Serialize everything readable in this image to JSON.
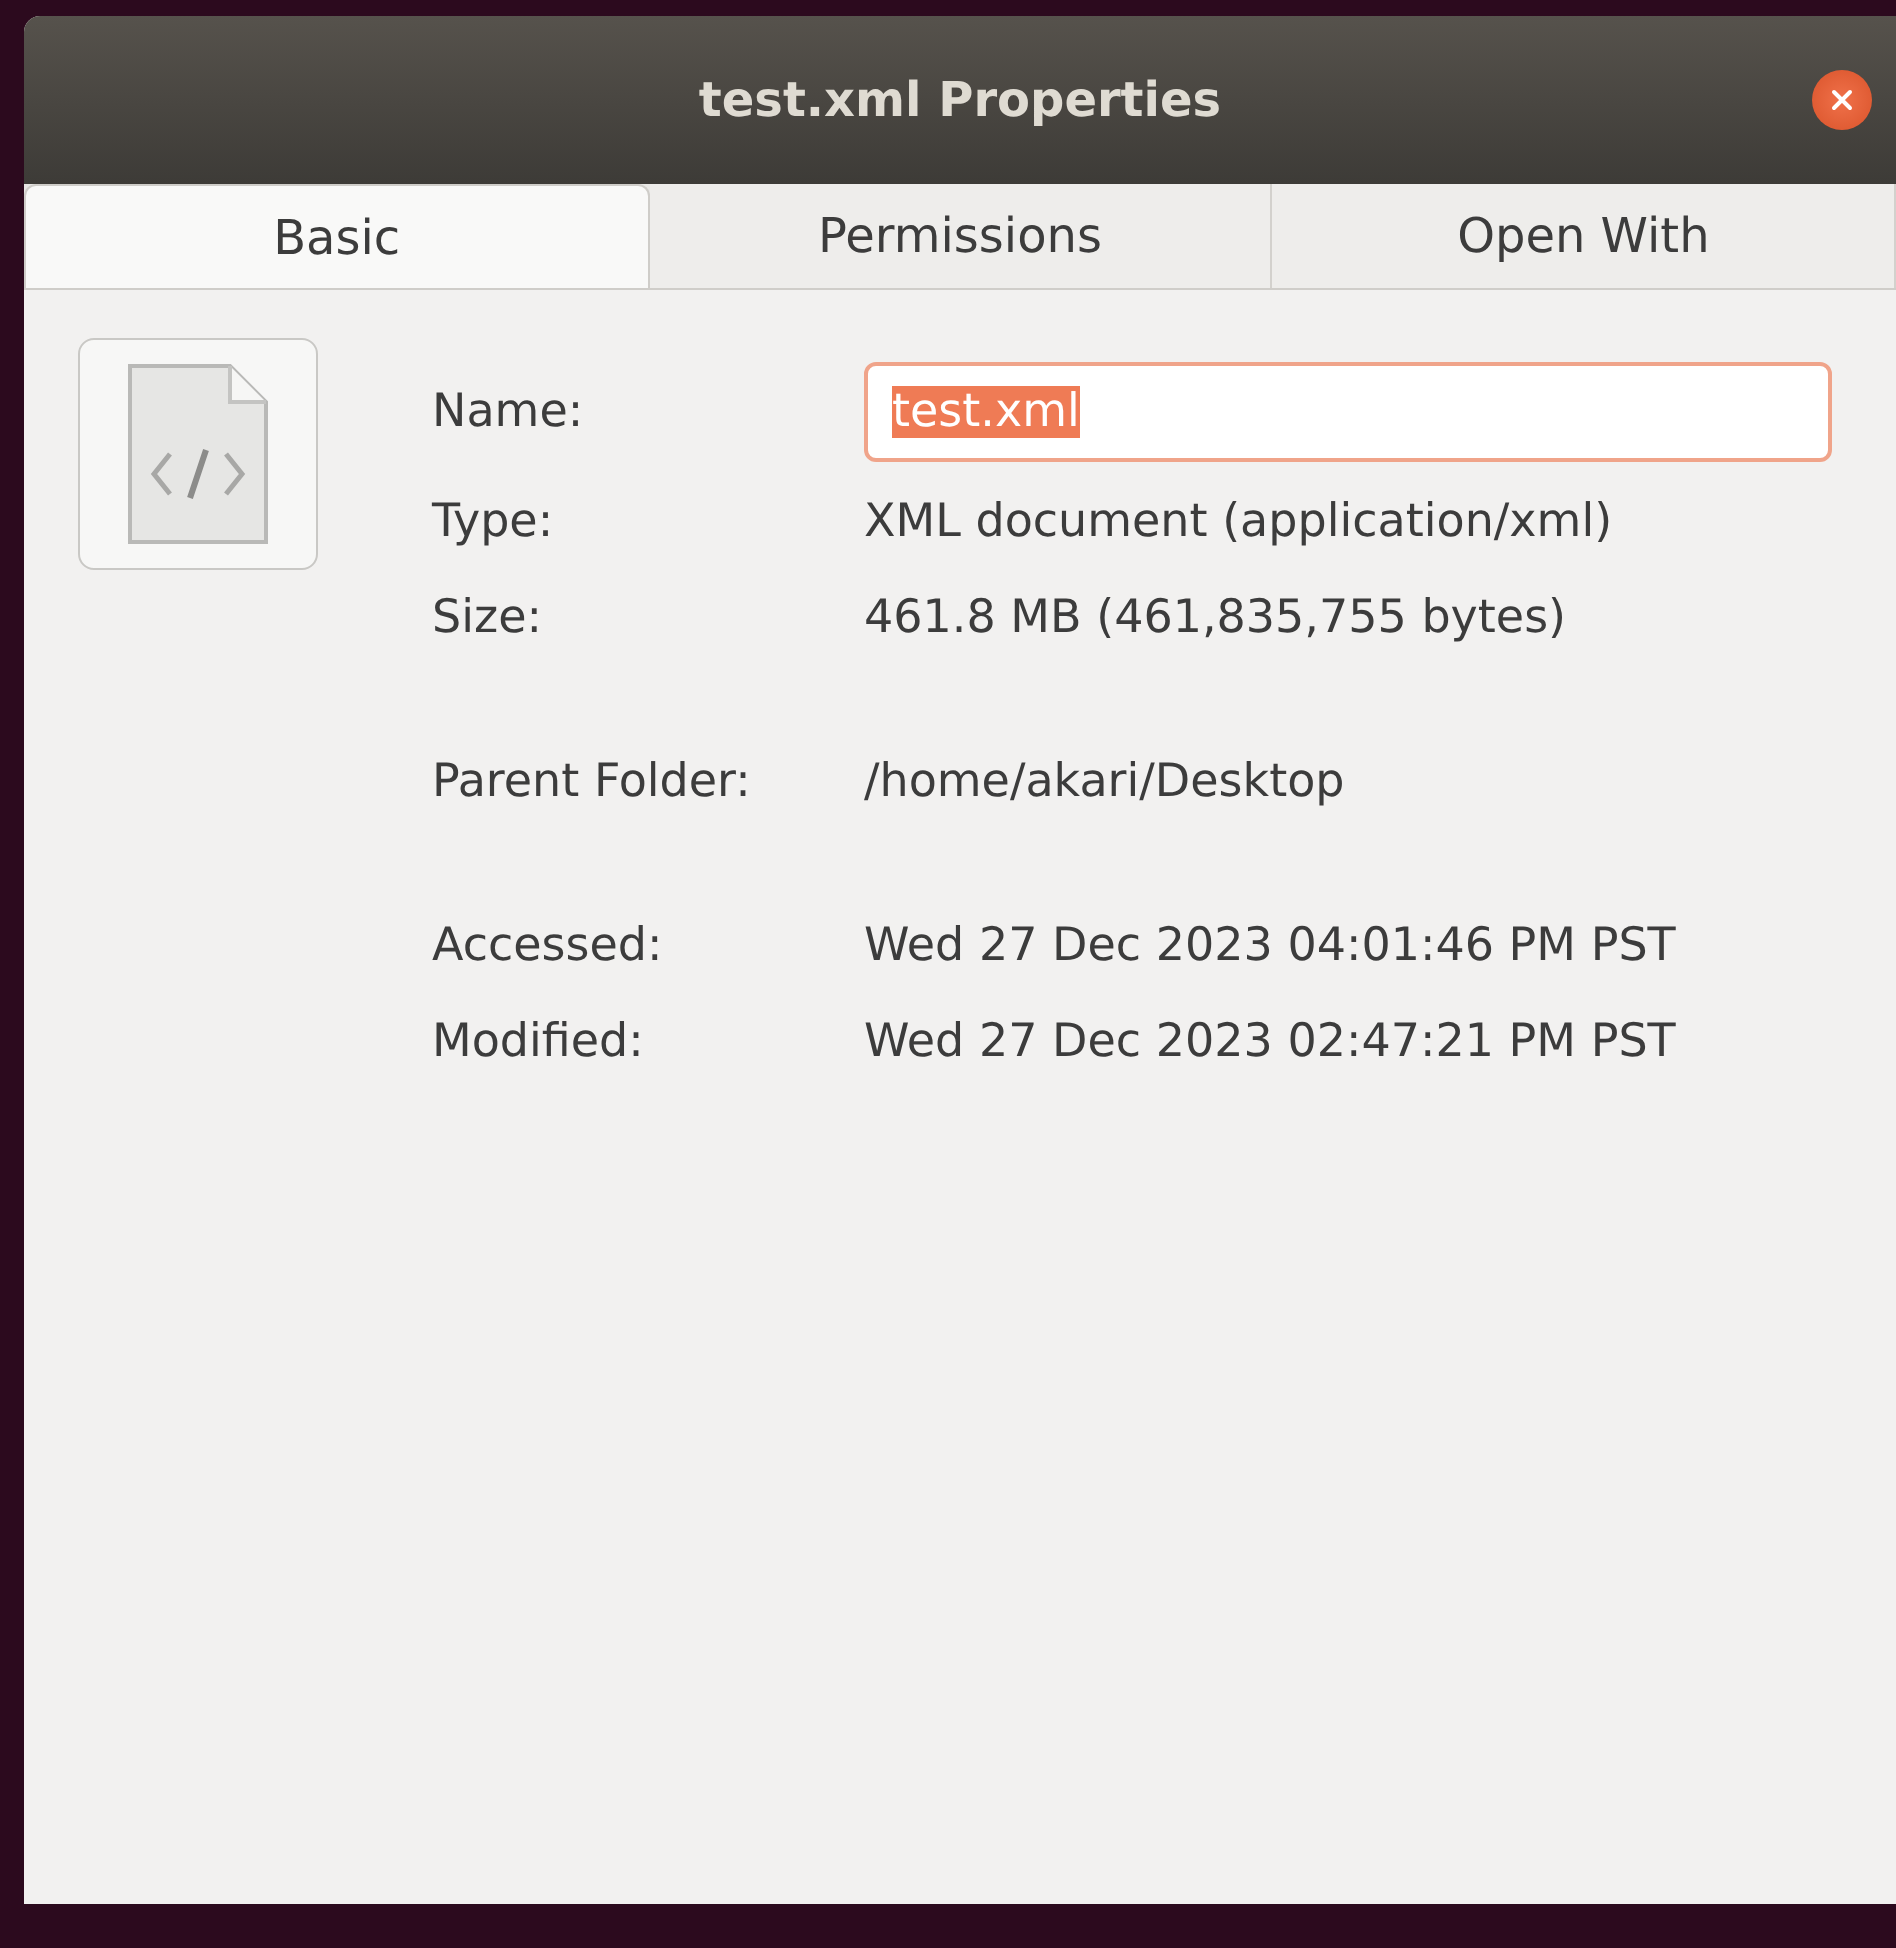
{
  "window": {
    "title": "test.xml Properties"
  },
  "tabs": [
    {
      "label": "Basic",
      "selected": true
    },
    {
      "label": "Permissions",
      "selected": false
    },
    {
      "label": "Open With",
      "selected": false
    }
  ],
  "groups": [
    [
      {
        "label": "Name:",
        "kind": "field",
        "value": "test.xml",
        "text_selected": true
      },
      {
        "label": "Type:",
        "kind": "text",
        "value": "XML document (application/xml)"
      },
      {
        "label": "Size:",
        "kind": "text",
        "value": "461.8 MB (461,835,755 bytes)"
      }
    ],
    [
      {
        "label": "Parent Folder:",
        "kind": "text",
        "value": "/home/akari/Desktop"
      }
    ],
    [
      {
        "label": "Accessed:",
        "kind": "text",
        "value": "Wed 27 Dec 2023 04:01:46 PM PST"
      },
      {
        "label": "Modified:",
        "kind": "text",
        "value": "Wed 27 Dec 2023 02:47:21 PM PST"
      }
    ]
  ]
}
